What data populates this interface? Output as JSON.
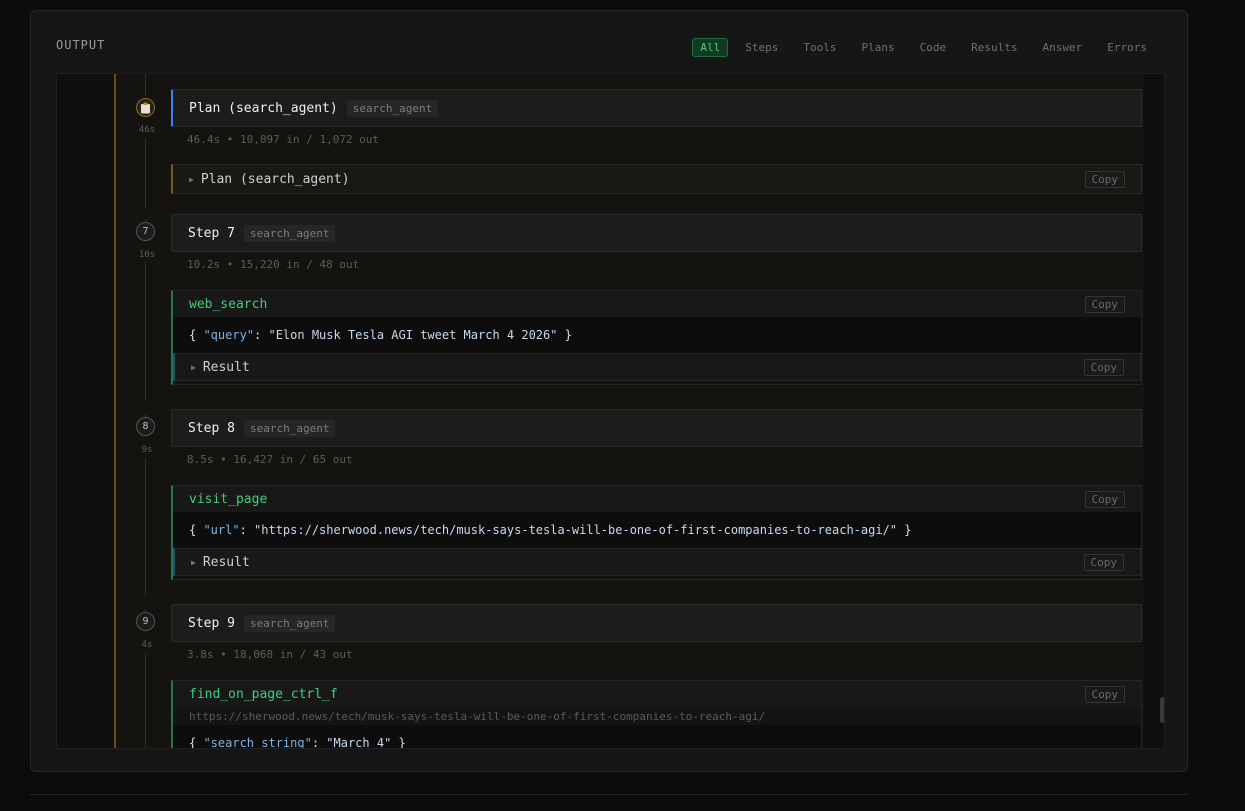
{
  "panel": {
    "title": "OUTPUT"
  },
  "filters": [
    {
      "label": "All",
      "active": true
    },
    {
      "label": "Steps"
    },
    {
      "label": "Tools"
    },
    {
      "label": "Plans"
    },
    {
      "label": "Code"
    },
    {
      "label": "Results"
    },
    {
      "label": "Answer"
    },
    {
      "label": "Errors"
    }
  ],
  "copy_label": "Copy",
  "plan": {
    "node_icon": "clipboard-icon",
    "time": "46s",
    "title": "Plan (search_agent)",
    "tag": "search_agent",
    "meta": "46.4s • 10,097 in / 1,072 out",
    "collapse_label": "Plan (search_agent)"
  },
  "steps": [
    {
      "num": "7",
      "time": "10s",
      "title": "Step 7",
      "tag": "search_agent",
      "meta": "10.2s • 15,220 in / 48 out",
      "tool": {
        "name": "web_search",
        "arg_key": "\"query\"",
        "arg_val": "\"Elon Musk Tesla AGI tweet March 4 2026\""
      },
      "result_label": "Result"
    },
    {
      "num": "8",
      "time": "9s",
      "title": "Step 8",
      "tag": "search_agent",
      "meta": "8.5s • 16,427 in / 65 out",
      "tool": {
        "name": "visit_page",
        "arg_key": "\"url\"",
        "arg_val": "\"https://sherwood.news/tech/musk-says-tesla-will-be-one-of-first-companies-to-reach-agi/\""
      },
      "result_label": "Result"
    },
    {
      "num": "9",
      "time": "4s",
      "title": "Step 9",
      "tag": "search_agent",
      "meta": "3.8s • 18,068 in / 43 out",
      "tool": {
        "name": "find_on_page_ctrl_f",
        "url": "https://sherwood.news/tech/musk-says-tesla-will-be-one-of-first-companies-to-reach-agi/",
        "arg_key": "\"search_string\"",
        "arg_val": "\"March 4\""
      }
    }
  ]
}
